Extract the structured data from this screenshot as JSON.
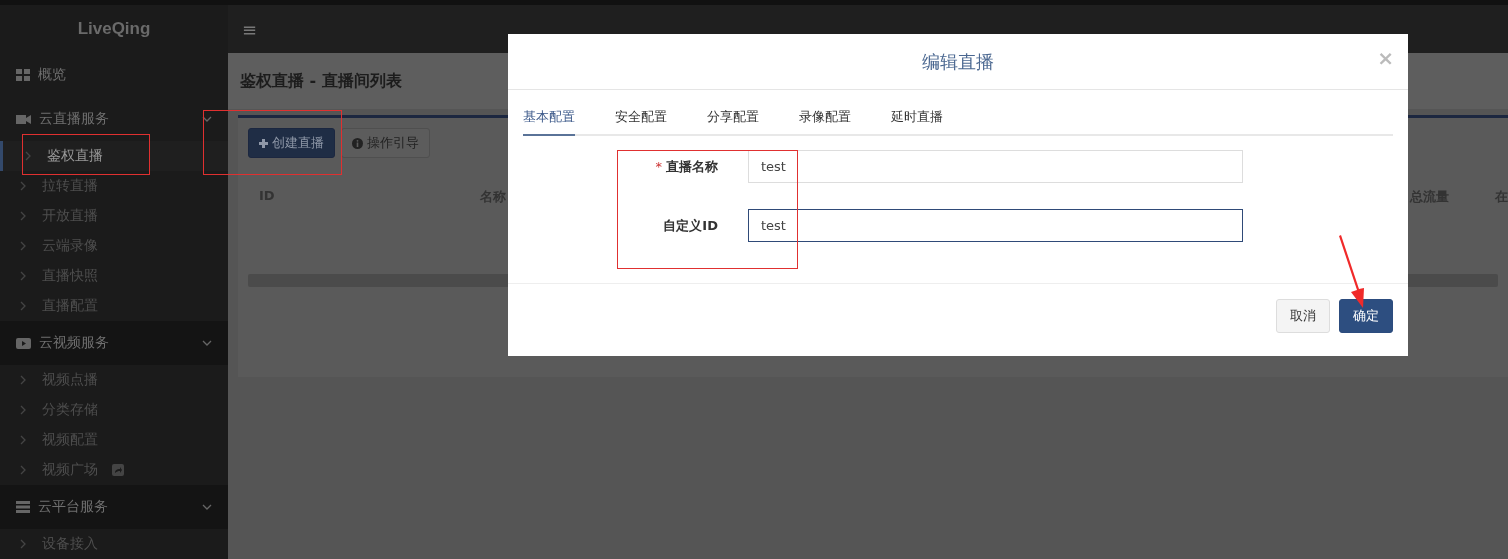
{
  "brand": "LiveQing",
  "topbar": {
    "menu_glyph": "≡"
  },
  "sidebar": {
    "groups": [
      {
        "label": "概览"
      },
      {
        "label": "云直播服务",
        "expanded": true,
        "items": [
          {
            "label": "鉴权直播",
            "selected": true
          },
          {
            "label": "拉转直播",
            "selected": false
          },
          {
            "label": "开放直播",
            "selected": false
          },
          {
            "label": "云端录像",
            "selected": false
          },
          {
            "label": "直播快照",
            "selected": false
          },
          {
            "label": "直播配置",
            "selected": false
          }
        ]
      },
      {
        "label": "云视频服务",
        "expanded": true,
        "items": [
          {
            "label": "视频点播",
            "selected": false
          },
          {
            "label": "分类存储",
            "selected": false
          },
          {
            "label": "视频配置",
            "selected": false
          },
          {
            "label": "视频广场",
            "selected": false,
            "external": true
          }
        ]
      },
      {
        "label": "云平台服务",
        "expanded": true,
        "items": [
          {
            "label": "设备接入",
            "selected": false
          }
        ]
      }
    ]
  },
  "page": {
    "title": "鉴权直播 - 直播间列表",
    "buttons": [
      {
        "kind": "primary",
        "label": "创建直播"
      },
      {
        "kind": "info",
        "label": "操作引导"
      }
    ],
    "table": {
      "columns": [
        "ID",
        "名称",
        "总流量",
        "在"
      ]
    }
  },
  "dialog": {
    "title": "编辑直播",
    "close": "×",
    "required_mark": "*",
    "tabs": [
      {
        "label": "基本配置",
        "selected": true
      },
      {
        "label": "安全配置",
        "selected": false
      },
      {
        "label": "分享配置",
        "selected": false
      },
      {
        "label": "录像配置",
        "selected": false
      },
      {
        "label": "延时直播",
        "selected": false
      }
    ],
    "fields": [
      {
        "label": "直播名称",
        "required": true,
        "value": "test",
        "focused": false
      },
      {
        "label": "自定义ID",
        "required": false,
        "value": "test",
        "focused": true
      }
    ],
    "buttons": [
      {
        "kind": "default",
        "label": "取消"
      },
      {
        "kind": "primary",
        "label": "确定"
      }
    ]
  }
}
